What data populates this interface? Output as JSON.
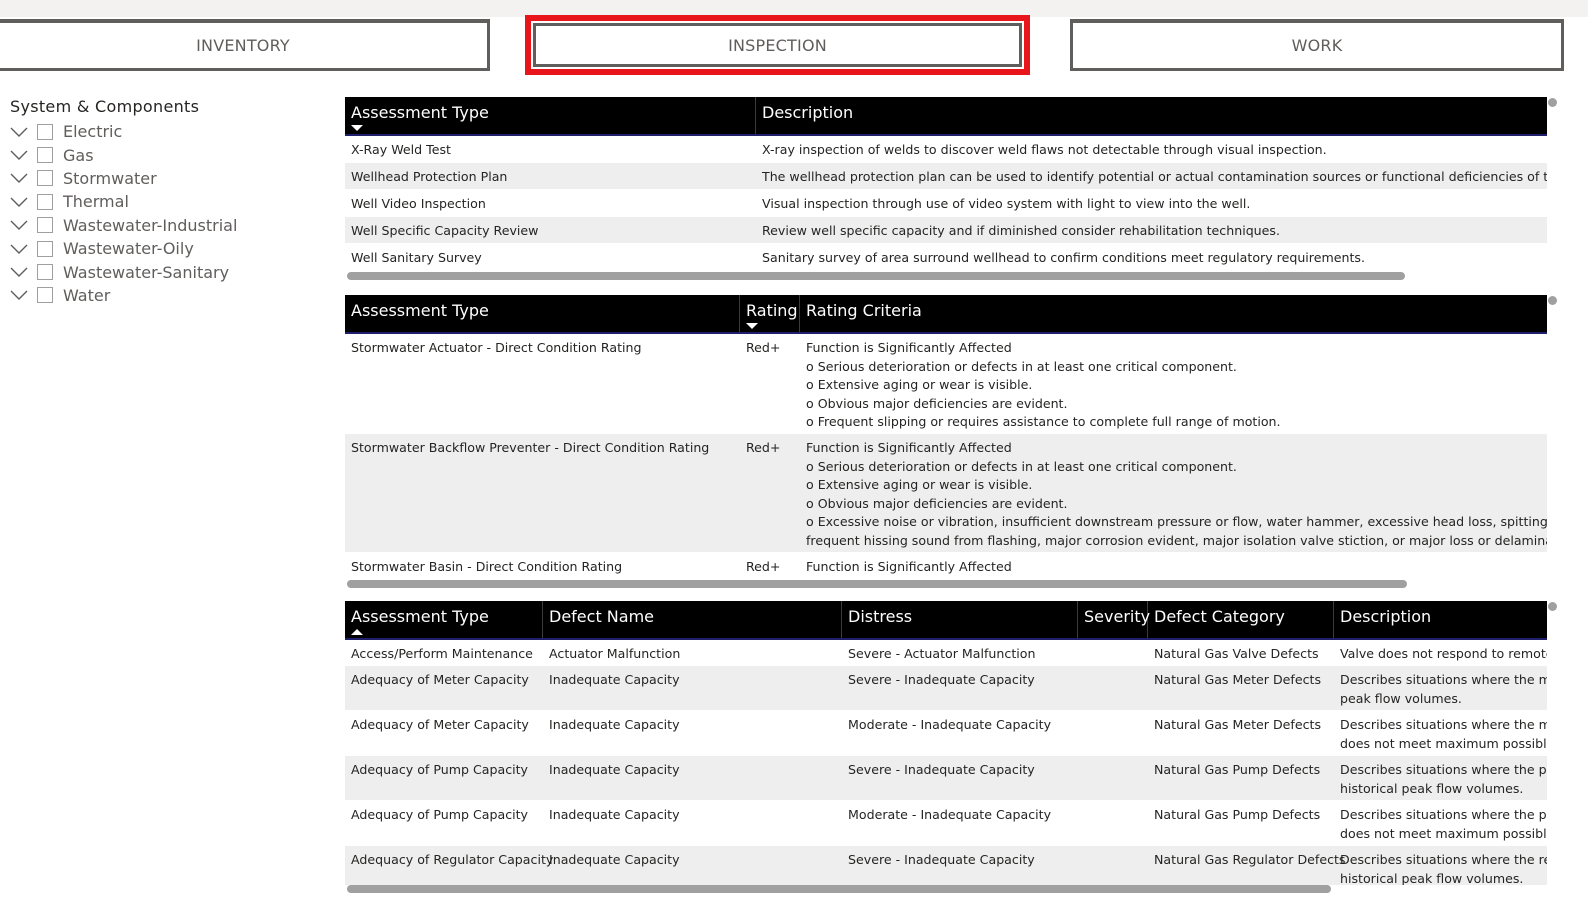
{
  "nav": {
    "inventory": "INVENTORY",
    "inspection": "INSPECTION",
    "work": "WORK",
    "highlight_color": "#e8151b"
  },
  "slicer": {
    "title": "System & Components",
    "items": [
      "Electric",
      "Gas",
      "Stormwater",
      "Thermal",
      "Wastewater-Industrial",
      "Wastewater-Oily",
      "Wastewater-Sanitary",
      "Water"
    ]
  },
  "table1": {
    "headers": [
      "Assessment Type",
      "Description"
    ],
    "sort": "descending",
    "rows": [
      [
        "X-Ray Weld Test",
        "X-ray inspection of welds to discover weld flaws not detectable through visual inspection."
      ],
      [
        "Wellhead Protection Plan",
        "The wellhead protection plan can be used to identify potential or actual contamination sources or functional deficiencies of the well."
      ],
      [
        "Well Video Inspection",
        "Visual inspection through use of video system with light to view into the well."
      ],
      [
        "Well Specific Capacity Review",
        "Review well specific capacity and if diminished consider rehabilitation techniques."
      ],
      [
        "Well Sanitary Survey",
        "Sanitary survey of area surround wellhead to confirm conditions meet regulatory requirements."
      ]
    ]
  },
  "table2": {
    "headers": [
      "Assessment Type",
      "Rating",
      "Rating Criteria"
    ],
    "sort": "descending",
    "rows": [
      {
        "type": "Stormwater Actuator - Direct Condition Rating",
        "rating": "Red+",
        "criteria": [
          "Function is Significantly Affected",
          "o Serious deterioration or defects in at least one critical component.",
          "o Extensive aging or wear is visible.",
          "o Obvious major deficiencies are evident.",
          "o Frequent slipping or requires assistance to complete full range of motion."
        ]
      },
      {
        "type": "Stormwater Backflow Preventer - Direct Condition Rating",
        "rating": "Red+",
        "criteria": [
          "Function is Significantly Affected",
          "o Serious deterioration or defects in at least one critical component.",
          "o Extensive aging or wear is visible.",
          "o Obvious major deficiencies are evident.",
          "o Excessive noise or vibration, insufficient downstream pressure or flow, water hammer, excessive head loss, spitting from interme",
          "frequent hissing sound from flashing, major corrosion evident, major isolation valve stiction, or major loss or delamination of coa"
        ]
      },
      {
        "type": "Stormwater Basin - Direct Condition Rating",
        "rating": "Red+",
        "criteria": [
          "Function is Significantly Affected"
        ]
      }
    ]
  },
  "table3": {
    "headers": [
      "Assessment Type",
      "Defect Name",
      "Distress",
      "Severity",
      "Defect Category",
      "Description"
    ],
    "sort": "ascending",
    "rows": [
      {
        "type": "Access/Perform Maintenance",
        "defect": "Actuator Malfunction",
        "distress": "Severe - Actuator Malfunction",
        "severity": "",
        "category": "Natural Gas Valve Defects",
        "desc": [
          "Valve does not respond to remote c"
        ]
      },
      {
        "type": "Adequacy of Meter Capacity",
        "defect": "Inadequate Capacity",
        "distress": "Severe - Inadequate Capacity",
        "severity": "",
        "category": "Natural Gas Meter Defects",
        "desc": [
          "Describes situations where the mete",
          "peak flow volumes."
        ]
      },
      {
        "type": "Adequacy of Meter Capacity",
        "defect": "Inadequate Capacity",
        "distress": "Moderate - Inadequate Capacity",
        "severity": "",
        "category": "Natural Gas Meter Defects",
        "desc": [
          "Describes situations where the mete",
          "does not meet maximum possible p"
        ]
      },
      {
        "type": "Adequacy of Pump Capacity",
        "defect": "Inadequate Capacity",
        "distress": "Severe - Inadequate Capacity",
        "severity": "",
        "category": "Natural Gas Pump Defects",
        "desc": [
          "Describes situations where the pum",
          "historical peak flow volumes."
        ]
      },
      {
        "type": "Adequacy of Pump Capacity",
        "defect": "Inadequate Capacity",
        "distress": "Moderate - Inadequate Capacity",
        "severity": "",
        "category": "Natural Gas Pump Defects",
        "desc": [
          "Describes situations where the pum",
          "does not meet maximum possible p"
        ]
      },
      {
        "type": "Adequacy of Regulator Capacity",
        "defect": "Inadequate Capacity",
        "distress": "Severe - Inadequate Capacity",
        "severity": "",
        "category": "Natural Gas Regulator Defects",
        "desc": [
          "Describes situations where the regu",
          "historical peak flow volumes."
        ]
      }
    ]
  }
}
